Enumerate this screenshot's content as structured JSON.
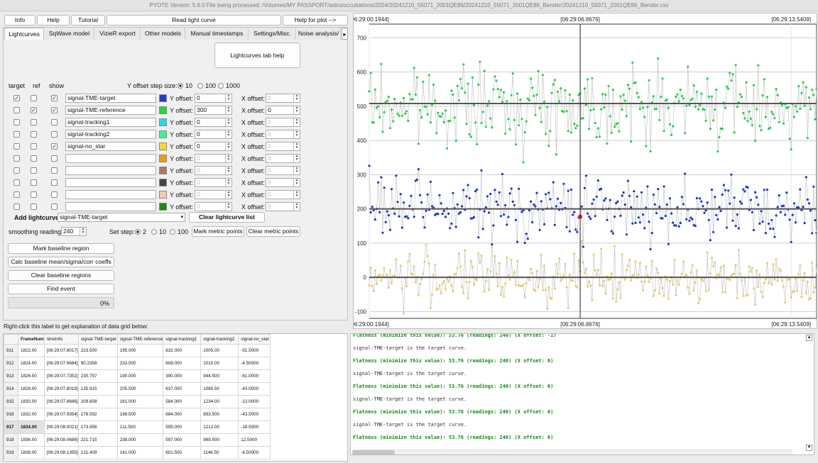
{
  "window_title": "PYOTE Version: 5.6.0  File being processed: /Volumes/MY PASSPORT/astro/occultations/2024/20241210_55071_2001QE86/20241210_55071_2001QE86_Bender/20241210_55071_2001QE86_Bender.csv",
  "toolbar": {
    "info": "Info",
    "help": "Help",
    "tutorial": "Tutorial",
    "read_lc": "Read light curve",
    "help_plot": "Help for plot -->"
  },
  "tabs": [
    "Lightcurves",
    "SqWave model",
    "VizieR export",
    "Other models",
    "Manual timestamps",
    "Settings/Misc.",
    "Noise analysis/"
  ],
  "tab_arrow": "▸",
  "lc_help": "Lightcurves tab help",
  "headers": {
    "target": "target",
    "ref": "ref",
    "show": "show"
  },
  "y_step": {
    "label": "Y offset step size:",
    "options": [
      "10",
      "100",
      "1000"
    ],
    "selected": "10"
  },
  "labels": {
    "y_offset": "Y offset:",
    "x_offset": "X offset:"
  },
  "rows": [
    {
      "target": "✓",
      "ref": "",
      "show": "✓",
      "name": "signal-TME-target",
      "color": "#1f3ecb",
      "y": "0",
      "x": "0",
      "y_en": true,
      "x_en": false
    },
    {
      "target": "",
      "ref": "✓",
      "show": "✓",
      "name": "signal-TME-reference",
      "color": "#22d83a",
      "y": "300",
      "x": "0",
      "y_en": true,
      "x_en": true
    },
    {
      "target": "",
      "ref": "",
      "show": "",
      "name": "signal-tracking1",
      "color": "#2ad6ef",
      "y": "0",
      "x": "0",
      "y_en": true,
      "x_en": false
    },
    {
      "target": "",
      "ref": "",
      "show": "",
      "name": "signal-tracking2",
      "color": "#43f09b",
      "y": "0",
      "x": "0",
      "y_en": true,
      "x_en": false
    },
    {
      "target": "",
      "ref": "",
      "show": "✓",
      "name": "signal-no_star",
      "color": "#f6da2a",
      "y": "0",
      "x": "0",
      "y_en": true,
      "x_en": false
    },
    {
      "target": "",
      "ref": "",
      "show": "",
      "name": "",
      "color": "#f39a12",
      "y": "0",
      "x": "0",
      "y_en": false,
      "x_en": false
    },
    {
      "target": "",
      "ref": "",
      "show": "",
      "name": "",
      "color": "#a37c6a",
      "y": "0",
      "x": "0",
      "y_en": false,
      "x_en": false
    },
    {
      "target": "",
      "ref": "",
      "show": "",
      "name": "",
      "color": "#444444",
      "y": "0",
      "x": "0",
      "y_en": false,
      "x_en": false
    },
    {
      "target": "",
      "ref": "",
      "show": "",
      "name": "",
      "color": "#f9c9ac",
      "y": "0",
      "x": "0",
      "y_en": false,
      "x_en": false
    },
    {
      "target": "",
      "ref": "",
      "show": "",
      "name": "",
      "color": "#1d8a1d",
      "y": "0",
      "x": "0",
      "y_en": false,
      "x_en": false
    }
  ],
  "add_lc": {
    "label": "Add lightcurve",
    "value": "signal-TME-target",
    "clear": "Clear lightcurve list"
  },
  "smoothing": {
    "label": "smoothing readings",
    "value": "240"
  },
  "set_step": {
    "label": "Set step:",
    "options": [
      "2",
      "10",
      "100"
    ],
    "selected": "2"
  },
  "metric": {
    "mark": "Mark metric points",
    "clear": "Clear metric points"
  },
  "actions": [
    "Mark baseline region",
    "Calc baseline mean/sigma/corr coeffs",
    "Clear baseline regions",
    "Find event"
  ],
  "progress": {
    "value": 0,
    "label": "0%"
  },
  "grid_label": "Right-click this label to get explanation of data grid below:",
  "grid": {
    "columns": [
      "FrameNum",
      "timeInfo",
      "signal-TME-target",
      "signal-TME-reference",
      "signal-tracking1",
      "signal-tracking2",
      "signal-no_star"
    ],
    "rows": [
      [
        "911",
        "1822.00",
        "[06:29:07.6017]",
        "223.500",
        "195.000",
        "632.000",
        "1005.00",
        "-51.5000"
      ],
      [
        "912",
        "1824.00",
        "[06:29:07.6684]",
        "90.2358",
        "233.500",
        "608.000",
        "1010.00",
        "-4.50000"
      ],
      [
        "913",
        "1826.00",
        "[06:29:07.7352]",
        "230.757",
        "190.000",
        "390.000",
        "944.500",
        "-61.0000"
      ],
      [
        "914",
        "1828.00",
        "[06:29:07.8019]",
        "135.915",
        "205.500",
        "637.000",
        "1085.50",
        "-43.0000"
      ],
      [
        "915",
        "1830.00",
        "[06:29:07.8686]",
        "209.808",
        "161.000",
        "584.000",
        "1234.00",
        "-13.0000"
      ],
      [
        "916",
        "1832.00",
        "[06:29:07.9354]",
        "278.592",
        "198.500",
        "684.000",
        "893.500",
        "-43.5000"
      ],
      [
        "917",
        "1834.00",
        "[06:29:08.0021]",
        "173.956",
        "211.500",
        "595.000",
        "1212.00",
        "-18.5000"
      ],
      [
        "918",
        "1836.00",
        "[06:29:08.0688]",
        "221.715",
        "238.000",
        "597.000",
        "969.500",
        "12.5000"
      ],
      [
        "919",
        "1838.00",
        "[06:29:08.1355]",
        "131.409",
        "141.000",
        "601.500",
        "1146.50",
        "-6.50000"
      ]
    ]
  },
  "log": [
    {
      "t": "Flatness (minimize this value): 53.76 (readings: 240) (X offset: -1)",
      "c": "green"
    },
    {
      "t": "signal-TME-target is the target curve.",
      "c": "grey"
    },
    {
      "t": "Flatness (minimize this value): 53.76 (readings: 240) (X offset: 0)",
      "c": "green"
    },
    {
      "t": "signal-TME-target is the target curve.",
      "c": "grey"
    },
    {
      "t": "Flatness (minimize this value): 53.76 (readings: 240) (X offset: 0)",
      "c": "green"
    },
    {
      "t": "signal-TME-target is the target curve.",
      "c": "grey"
    },
    {
      "t": "Flatness (minimize this value): 53.76 (readings: 240) (X offset: 0)",
      "c": "green"
    },
    {
      "t": "signal-TME-target is the target curve.",
      "c": "grey"
    },
    {
      "t": "Flatness (minimize this value): 53.76 (readings: 240) (X offset: 0)",
      "c": "green"
    }
  ],
  "chart_data": {
    "type": "scatter",
    "time_ticks": [
      "[06:29:00.1944]",
      "[06:29:06.8676]",
      "[06:29:13.5409]"
    ],
    "ylim": [
      -120,
      740
    ],
    "y_ticks": [
      700,
      600,
      500,
      400,
      300,
      200,
      100,
      0,
      -100
    ],
    "n_points": 300,
    "cursor_index": 141,
    "series": [
      {
        "color": "#2d9c4a",
        "dot": "#1ed34a",
        "mean": 503,
        "spread": 55,
        "baseline": 508
      },
      {
        "color": "#2b3fa8",
        "dot": "#1c35c9",
        "mean": 200,
        "spread": 45,
        "baseline": 200
      },
      {
        "color": "#d9c46a",
        "dot": "#e3cf6f",
        "mean": 0,
        "spread": 38,
        "baseline": 0
      }
    ],
    "highlight": {
      "value": 177,
      "color": "#ff1a1a"
    }
  }
}
